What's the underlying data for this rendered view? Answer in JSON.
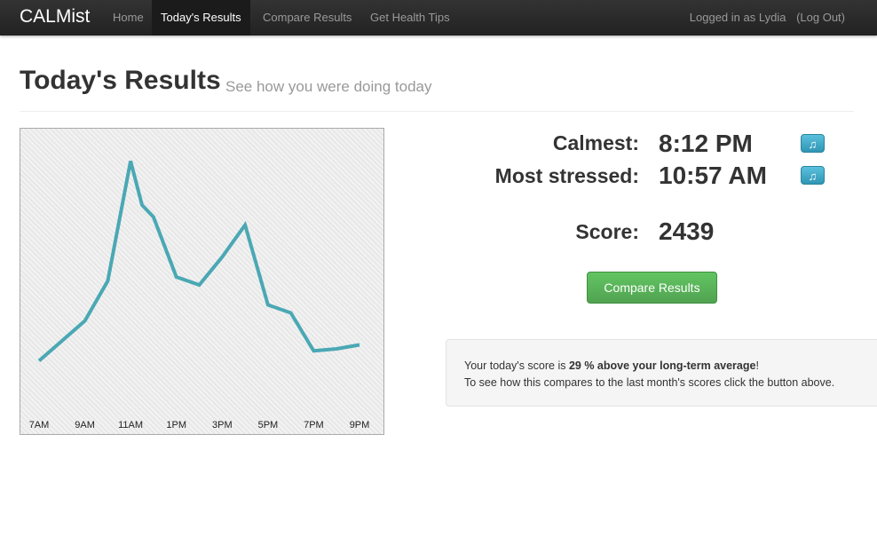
{
  "navbar": {
    "brand": "CALMist",
    "items": [
      {
        "label": "Home",
        "active": false
      },
      {
        "label": "Today's Results",
        "active": true
      },
      {
        "label": "Compare Results",
        "active": false
      },
      {
        "label": "Get Health Tips",
        "active": false
      }
    ],
    "user_text": "Logged in as Lydia",
    "logout_label": "(Log Out)"
  },
  "header": {
    "title": "Today's Results",
    "subtitle": "See how you were doing today"
  },
  "stats": {
    "calmest_label": "Calmest:",
    "calmest_value": "8:12 PM",
    "stressed_label": "Most stressed:",
    "stressed_value": "10:57 AM",
    "score_label": "Score:",
    "score_value": "2439",
    "music_icon": "music-note-icon"
  },
  "actions": {
    "compare_label": "Compare Results"
  },
  "summary": {
    "line1_prefix": "Your today's score is ",
    "line1_bold": "29 % above your long-term average",
    "line1_suffix": "!",
    "line2": "To see how this compares to the last month's scores click the button above."
  },
  "colors": {
    "line": "#4aa8b4",
    "primary_button": "#5bb75b",
    "info_button": "#49afcd"
  },
  "chart_data": {
    "type": "line",
    "categories": [
      "7AM",
      "9AM",
      "11AM",
      "1PM",
      "3PM",
      "5PM",
      "7PM",
      "9PM"
    ],
    "series": [
      {
        "x": [
          7,
          8,
          9,
          10,
          11,
          11.5,
          12,
          13,
          14,
          15,
          16,
          17,
          18,
          19,
          20,
          21
        ],
        "values": [
          10,
          20,
          30,
          50,
          110,
          88,
          82,
          52,
          48,
          62,
          78,
          38,
          34,
          15,
          16,
          18
        ]
      }
    ],
    "ylim": [
      0,
      120
    ],
    "grid": false
  }
}
